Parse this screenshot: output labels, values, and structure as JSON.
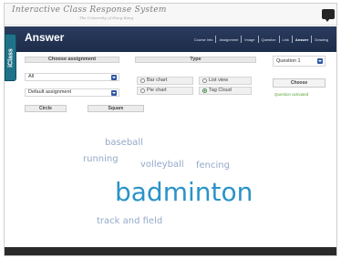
{
  "app": {
    "logo_title": "Interactive Class Response System",
    "logo_subtitle": "The University of Hong Kong"
  },
  "header": {
    "title": "Answer",
    "side_tab": "iClass",
    "nav": [
      {
        "label": "Course Info"
      },
      {
        "label": "Assignment"
      },
      {
        "label": "Image"
      },
      {
        "label": "Question"
      },
      {
        "label": "Link"
      },
      {
        "label": "Answer"
      },
      {
        "label": "Drawing"
      }
    ]
  },
  "assignment": {
    "heading": "Choose assignment",
    "filter_value": "All",
    "assignment_value": "Default assignment",
    "circle_button": "Circle",
    "square_button": "Square"
  },
  "type_panel": {
    "heading": "Type",
    "options": [
      {
        "label": "Bar chart",
        "selected": false
      },
      {
        "label": "List view",
        "selected": false
      },
      {
        "label": "Pie chart",
        "selected": false
      },
      {
        "label": "Tag Cloud",
        "selected": true
      }
    ]
  },
  "question_panel": {
    "question_value": "Question 1",
    "choose_button": "Choose",
    "status_text": "Question activated"
  },
  "tag_cloud": [
    {
      "text": "baseball",
      "weight": 1
    },
    {
      "text": "running",
      "weight": 1
    },
    {
      "text": "volleyball",
      "weight": 1
    },
    {
      "text": "fencing",
      "weight": 1
    },
    {
      "text": "badminton",
      "weight": 5
    },
    {
      "text": "track and field",
      "weight": 1
    }
  ],
  "colors": {
    "header_bg": "#1d2c49",
    "accent": "#2f57a4",
    "cloud_small": "#93a9c9",
    "cloud_large": "#2a93c8",
    "status": "#5aa73b"
  }
}
